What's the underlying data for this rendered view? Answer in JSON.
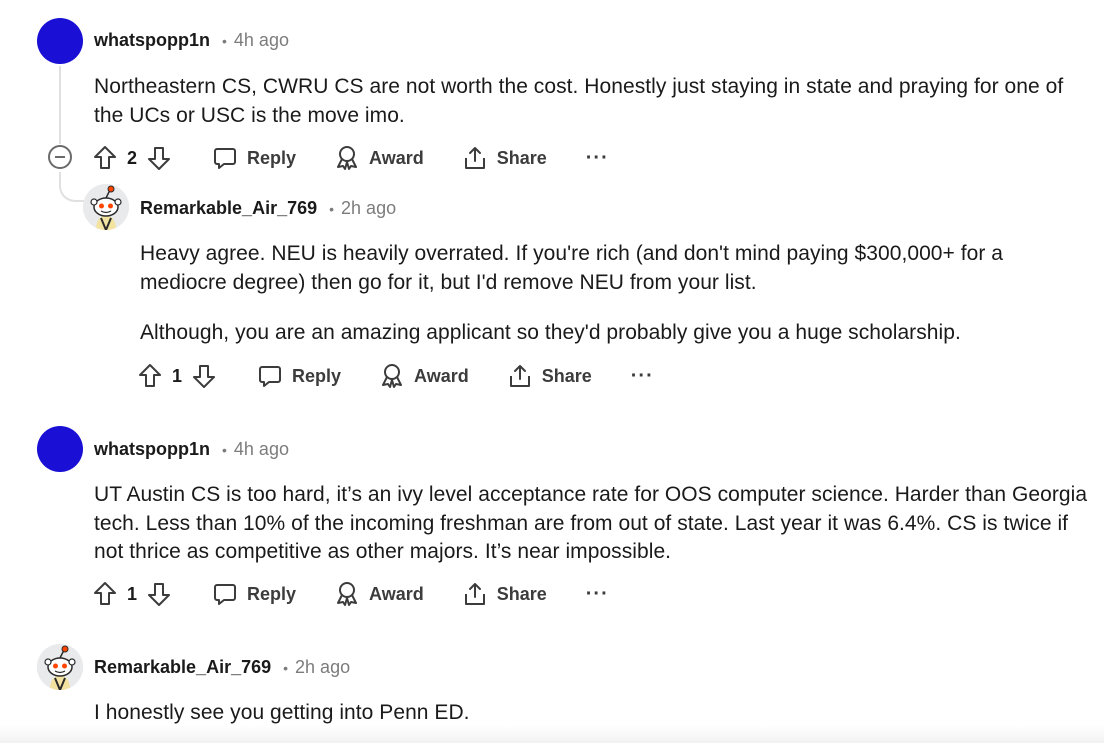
{
  "comments": [
    {
      "username": "whatspopp1n",
      "dot": "•",
      "time": "4h ago",
      "paragraphs": [
        "Northeastern CS, CWRU CS are not worth the cost. Honestly just staying in state and praying for one of the UCs or USC is the move imo."
      ],
      "votes": "2",
      "reply": "Reply",
      "award": "Award",
      "share": "Share",
      "more": "···"
    },
    {
      "username": "Remarkable_Air_769",
      "dot": "•",
      "time": "2h ago",
      "paragraphs": [
        "Heavy agree. NEU is heavily overrated. If you're rich (and don't mind paying $300,000+ for a mediocre degree) then go for it, but I'd remove NEU from your list.",
        "Although, you are an amazing applicant so they'd probably give you a huge scholarship."
      ],
      "votes": "1",
      "reply": "Reply",
      "award": "Award",
      "share": "Share",
      "more": "···"
    },
    {
      "username": "whatspopp1n",
      "dot": "•",
      "time": "4h ago",
      "paragraphs": [
        "UT Austin CS is too hard, it’s an ivy level acceptance rate for OOS computer science. Harder than Georgia tech. Less than 10% of the incoming freshman are from out of state. Last year it was 6.4%. CS is twice if not thrice as competitive as other majors. It’s near impossible."
      ],
      "votes": "1",
      "reply": "Reply",
      "award": "Award",
      "share": "Share",
      "more": "···"
    },
    {
      "username": "Remarkable_Air_769",
      "dot": "•",
      "time": "2h ago",
      "paragraphs": [
        "I honestly see you getting into Penn ED."
      ]
    }
  ],
  "icons": {
    "upvote": "upvote-arrow-icon",
    "downvote": "downvote-arrow-icon",
    "reply": "speech-bubble-icon",
    "award": "award-ribbon-icon",
    "share": "share-upload-icon",
    "collapse": "collapse-minus-icon"
  },
  "colors": {
    "avatar_blue": "#1a0fd4",
    "text": "#1a1a1b",
    "meta": "#7c7c7c",
    "action": "#3c3c3c",
    "thread_line": "#e0e0e0"
  }
}
